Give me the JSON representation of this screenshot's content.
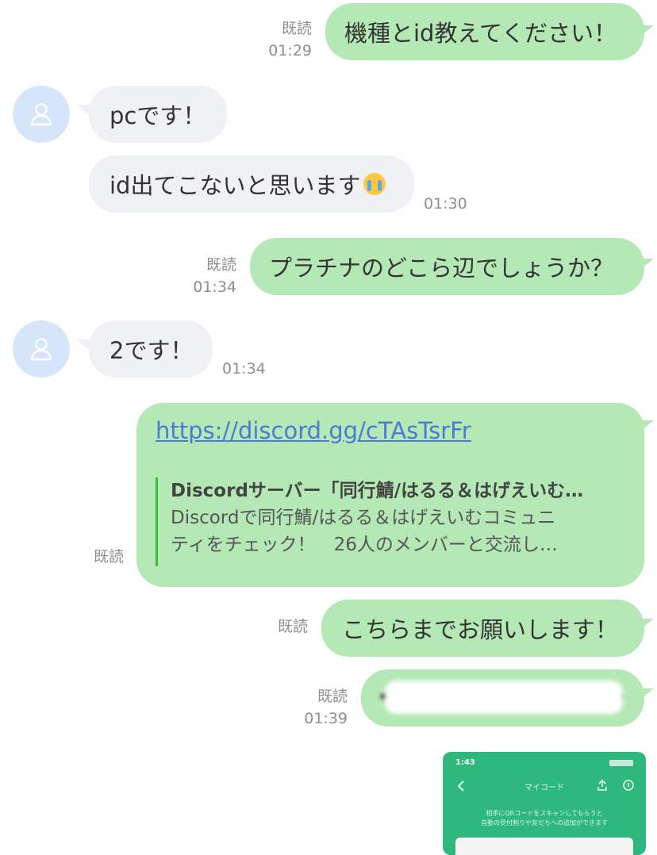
{
  "colors": {
    "outgoing_bubble": "#b4e8b4",
    "incoming_bubble": "#f0f1f4",
    "avatar_bg": "#d7e5fb",
    "link": "#4a7bd8",
    "meta_text": "#8b8f95",
    "preview_bar": "#3bbd3b",
    "screenshot_bg": "#2fb87d"
  },
  "messages": [
    {
      "side": "out",
      "text": "機種とid教えてください！",
      "read": "既読",
      "time": "01:29"
    },
    {
      "side": "in",
      "text": "pcです！",
      "avatar_icon": "person-icon"
    },
    {
      "side": "in",
      "text": "id出てこないと思います",
      "emoji": "loudly-crying-face-icon",
      "time": "01:30"
    },
    {
      "side": "out",
      "text": "プラチナのどこら辺でしょうか？",
      "read": "既読",
      "time": "01:34"
    },
    {
      "side": "in",
      "text": "2です！",
      "avatar_icon": "person-icon",
      "time": "01:34"
    },
    {
      "side": "out",
      "link": "https://discord.gg/cTAsTsrFr",
      "preview_title": "Discordサーバー「同行鯖/はるる＆はげえいむ…",
      "preview_desc_line1": "Discordで同行鯖/はるる＆はげえいむコミュニ",
      "preview_desc_line2": "ティをチェック！　26人のメンバーと交流し…",
      "read": "既読"
    },
    {
      "side": "out",
      "text": "こちらまでお願いします！",
      "read": "既読"
    },
    {
      "side": "out",
      "text_redacted": true,
      "read": "既読",
      "time": "01:39"
    }
  ],
  "image_preview": {
    "status_time": "1:43",
    "title": "マイコード",
    "caption_line1": "相手にQRコードをスキャンしてもらうと",
    "caption_line2": "自動の受付割りや友だちへの追加ができます",
    "back_icon": "chevron-left-icon",
    "share_icon": "share-icon",
    "info_icon": "info-icon"
  }
}
